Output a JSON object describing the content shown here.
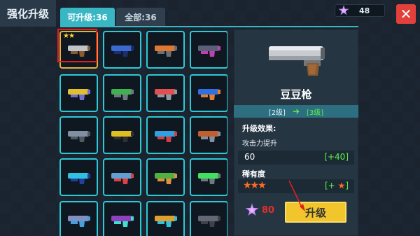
{
  "page_title": "强化升级",
  "tabs": {
    "upgradable": "可升级:36",
    "all": "全部:36"
  },
  "currency": {
    "amount": "48"
  },
  "close_label": "✕",
  "selected_item": {
    "name": "豆豆枪",
    "current_level": "[2级]",
    "next_level": "[3级]",
    "effect_label": "升级效果:",
    "effect_desc": "攻击力提升",
    "attack_value": "60",
    "attack_increase": "[+40]",
    "rarity_label": "稀有度",
    "rarity_stars": "★★★",
    "rarity_increase_prefix": "[+",
    "rarity_increase_star": "★",
    "rarity_increase_suffix": "]",
    "upgrade_cost": "80",
    "upgrade_button": "升级"
  },
  "grid_items": [
    {
      "name": "pea-pistol",
      "stars": "★★",
      "selected": true,
      "colors": [
        "#c0c4c8",
        "#8a5a30"
      ]
    },
    {
      "name": "blue-blaster",
      "stars": "",
      "selected": false,
      "colors": [
        "#3a6ad0",
        "#1e2d70"
      ]
    },
    {
      "name": "orange-shotgun",
      "stars": "",
      "selected": false,
      "colors": [
        "#e07830",
        "#6a7078"
      ]
    },
    {
      "name": "sniper-rifle",
      "stars": "",
      "selected": false,
      "colors": [
        "#5a6078",
        "#c040b0"
      ]
    },
    {
      "name": "yellow-drill-gun",
      "stars": "",
      "selected": false,
      "colors": [
        "#e0c030",
        "#7070d0"
      ]
    },
    {
      "name": "green-plasma-gun",
      "stars": "",
      "selected": false,
      "colors": [
        "#40b050",
        "#707880"
      ]
    },
    {
      "name": "red-laser-gun",
      "stars": "",
      "selected": false,
      "colors": [
        "#e05050",
        "#909aa0"
      ]
    },
    {
      "name": "blue-cannon",
      "stars": "",
      "selected": false,
      "colors": [
        "#3070e0",
        "#e08030"
      ]
    },
    {
      "name": "grey-orb-gun",
      "stars": "",
      "selected": false,
      "colors": [
        "#8090a0",
        "#505860"
      ]
    },
    {
      "name": "hazard-launcher",
      "stars": "",
      "selected": false,
      "colors": [
        "#e0c020",
        "#303030"
      ]
    },
    {
      "name": "ring-blaster",
      "stars": "",
      "selected": false,
      "colors": [
        "#30a0e0",
        "#d04040"
      ]
    },
    {
      "name": "rocket-launcher",
      "stars": "",
      "selected": false,
      "colors": [
        "#c06030",
        "#8090a0"
      ]
    },
    {
      "name": "cyan-laser",
      "stars": "",
      "selected": false,
      "colors": [
        "#30c0e0",
        "#2040a0"
      ]
    },
    {
      "name": "shark-gun",
      "stars": "",
      "selected": false,
      "colors": [
        "#60a0d0",
        "#e04040"
      ]
    },
    {
      "name": "green-bazooka",
      "stars": "",
      "selected": false,
      "colors": [
        "#50b040",
        "#e09040"
      ]
    },
    {
      "name": "barrel-gun",
      "stars": "",
      "selected": false,
      "colors": [
        "#40e060",
        "#707880"
      ]
    },
    {
      "name": "tesla-gun",
      "stars": "",
      "selected": false,
      "colors": [
        "#8090c0",
        "#40a0e0"
      ]
    },
    {
      "name": "bubble-gun",
      "stars": "",
      "selected": false,
      "colors": [
        "#9040c0",
        "#40e0d0"
      ]
    },
    {
      "name": "spiral-gun",
      "stars": "",
      "selected": false,
      "colors": [
        "#e0a030",
        "#30c0e0"
      ]
    },
    {
      "name": "assault-rifle",
      "stars": "",
      "selected": false,
      "colors": [
        "#606878",
        "#404048"
      ]
    }
  ]
}
